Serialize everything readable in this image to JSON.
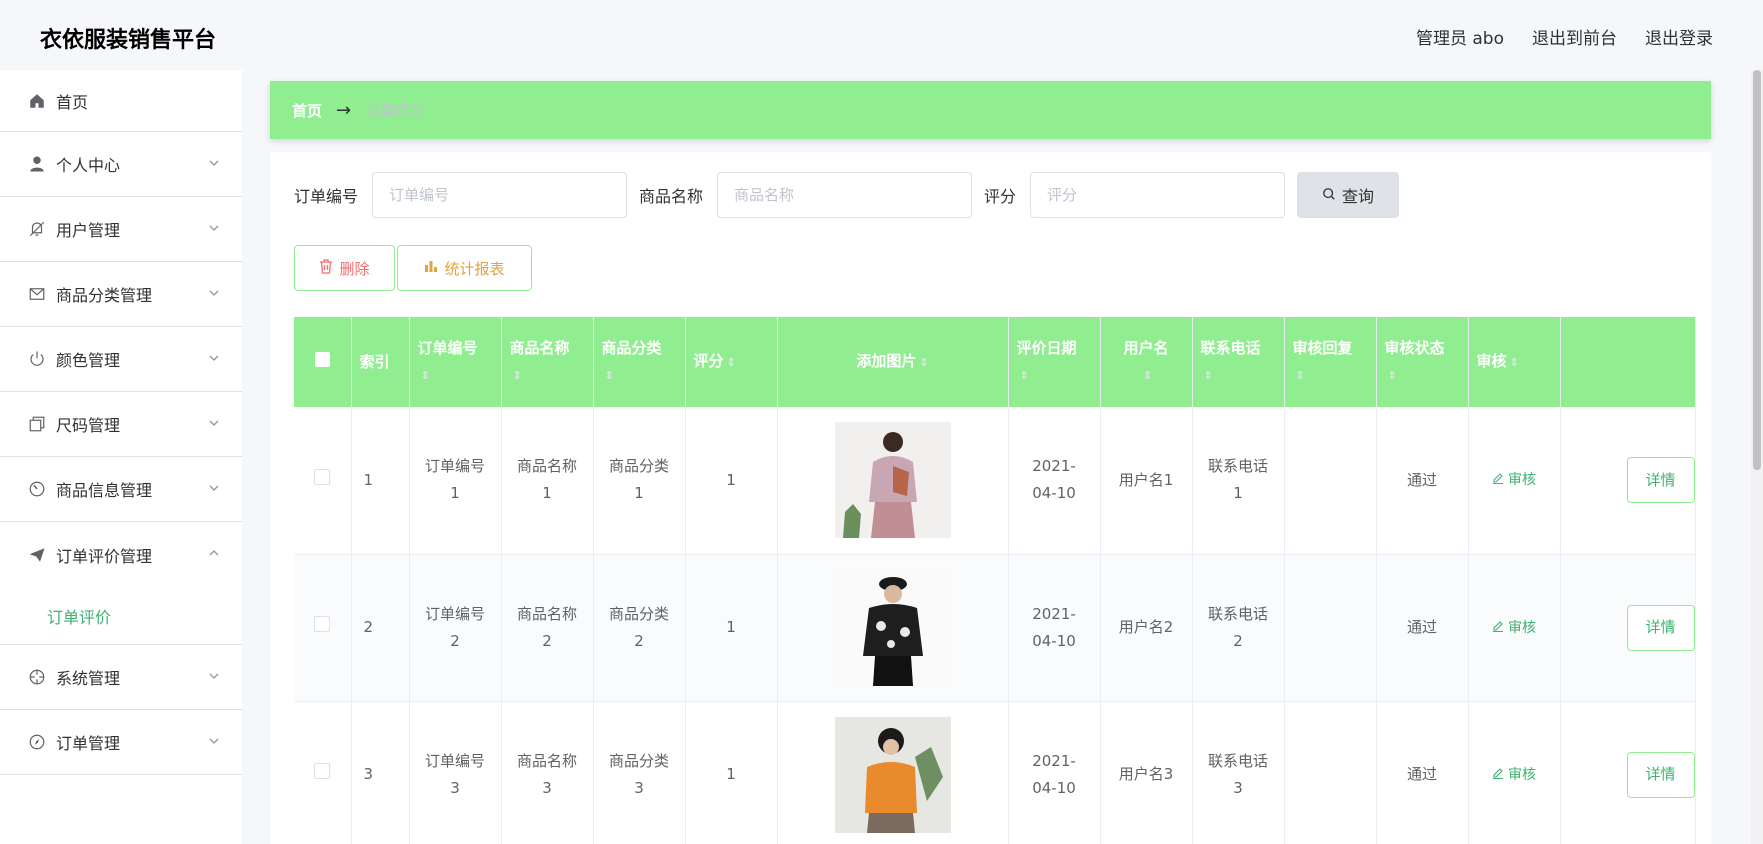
{
  "app": {
    "title": "衣依服装销售平台"
  },
  "topbar": {
    "admin": "管理员 abo",
    "to_front": "退出到前台",
    "logout": "退出登录"
  },
  "sidebar": {
    "items": [
      {
        "label": "首页",
        "icon": "home-icon"
      },
      {
        "label": "个人中心",
        "icon": "user-icon"
      },
      {
        "label": "用户管理",
        "icon": "bell-off-icon"
      },
      {
        "label": "商品分类管理",
        "icon": "mail-icon"
      },
      {
        "label": "颜色管理",
        "icon": "power-icon"
      },
      {
        "label": "尺码管理",
        "icon": "copy-icon"
      },
      {
        "label": "商品信息管理",
        "icon": "gauge-icon"
      },
      {
        "label": "订单评价管理",
        "icon": "send-icon"
      },
      {
        "label": "系统管理",
        "icon": "crosshair-icon"
      },
      {
        "label": "订单管理",
        "icon": "compass-icon"
      }
    ],
    "sub_active": "订单评价"
  },
  "breadcrumb": {
    "home": "首页",
    "current": "订单评价"
  },
  "search": {
    "order_label": "订单编号",
    "order_placeholder": "订单编号",
    "product_label": "商品名称",
    "product_placeholder": "商品名称",
    "score_label": "评分",
    "score_placeholder": "评分",
    "query_label": "查询"
  },
  "actions": {
    "delete_label": "删除",
    "stat_label": "统计报表"
  },
  "table": {
    "headers": [
      "索引",
      "订单编号",
      "商品名称",
      "商品分类",
      "评分",
      "添加图片",
      "评价日期",
      "用户名",
      "联系电话",
      "审核回复",
      "审核状态",
      "审核"
    ],
    "rows": [
      {
        "index": "1",
        "order": "订单编号1",
        "product": "商品名称1",
        "category": "商品分类1",
        "score": "1",
        "date": "2021-04-10",
        "user": "用户名1",
        "phone": "联系电话1",
        "reply": "",
        "status": "通过",
        "audit": "审核",
        "detail": "详情"
      },
      {
        "index": "2",
        "order": "订单编号2",
        "product": "商品名称2",
        "category": "商品分类2",
        "score": "1",
        "date": "2021-04-10",
        "user": "用户名2",
        "phone": "联系电话2",
        "reply": "",
        "status": "通过",
        "audit": "审核",
        "detail": "详情"
      },
      {
        "index": "3",
        "order": "订单编号3",
        "product": "商品名称3",
        "category": "商品分类3",
        "score": "1",
        "date": "2021-04-10",
        "user": "用户名3",
        "phone": "联系电话3",
        "reply": "",
        "status": "通过",
        "audit": "审核",
        "detail": "详情"
      }
    ]
  },
  "colors": {
    "accent": "#90ee90",
    "link": "#3cb371",
    "danger": "#f56c6c",
    "warning": "#e6a23c"
  }
}
